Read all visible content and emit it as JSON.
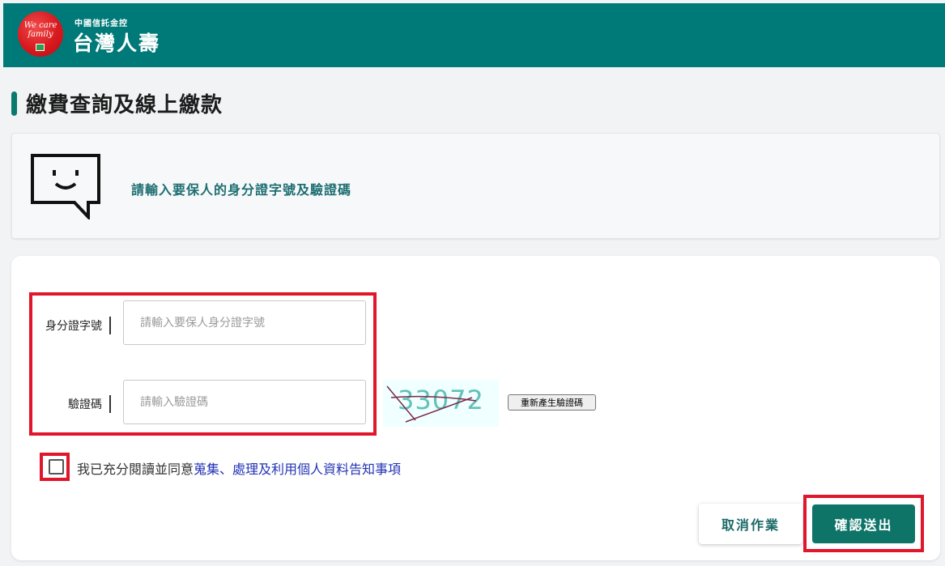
{
  "header": {
    "logo_lettering": "We care family",
    "brand_small": "中國信託金控",
    "brand_big": "台灣人壽"
  },
  "page": {
    "title": "繳費查詢及線上繳款"
  },
  "info": {
    "message": "請輸入要保人的身分證字號及驗證碼"
  },
  "form": {
    "id_label": "身分證字號",
    "id_placeholder": "請輸入要保人身分證字號",
    "id_value": "",
    "captcha_label": "驗證碼",
    "captcha_placeholder": "請輸入驗證碼",
    "captcha_value": "",
    "captcha_image_text": "33072",
    "regenerate_label": "重新產生驗證碼"
  },
  "agreement": {
    "prefix": "我已充分閱讀並同意",
    "link_text": "蒐集、處理及利用個人資料告知事項",
    "checked": false
  },
  "actions": {
    "cancel_label": "取消作業",
    "submit_label": "確認送出"
  },
  "colors": {
    "header": "#007a78",
    "accent_text": "#1d6e71",
    "submit": "#0e7468",
    "highlight": "#e0162b",
    "link": "#2233b5"
  }
}
